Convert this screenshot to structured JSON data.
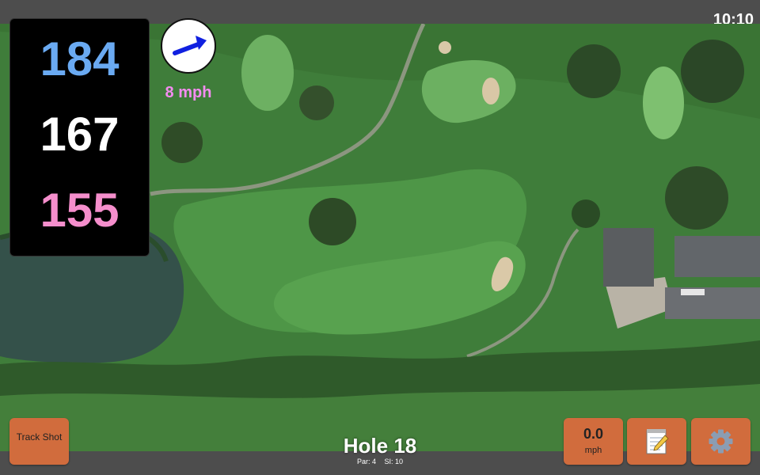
{
  "status": {
    "time": "10:10"
  },
  "distances": {
    "back": "184",
    "middle": "167",
    "front": "155"
  },
  "wind": {
    "speed": "8 mph",
    "arrow_color": "#1020e0"
  },
  "buttons": {
    "track_shot": "Track Shot",
    "speed_value": "0.0",
    "speed_unit": "mph",
    "notes_icon": "notepad-icon",
    "settings_icon": "gear-icon"
  },
  "hole": {
    "title": "Hole 18",
    "par": "Par: 4",
    "si": "SI: 10"
  },
  "colors": {
    "back_distance": "#6aaaf2",
    "middle_distance": "#ffffff",
    "front_distance": "#f58ecc",
    "button": "#d16c3d",
    "wind_label": "#f38cf0"
  }
}
